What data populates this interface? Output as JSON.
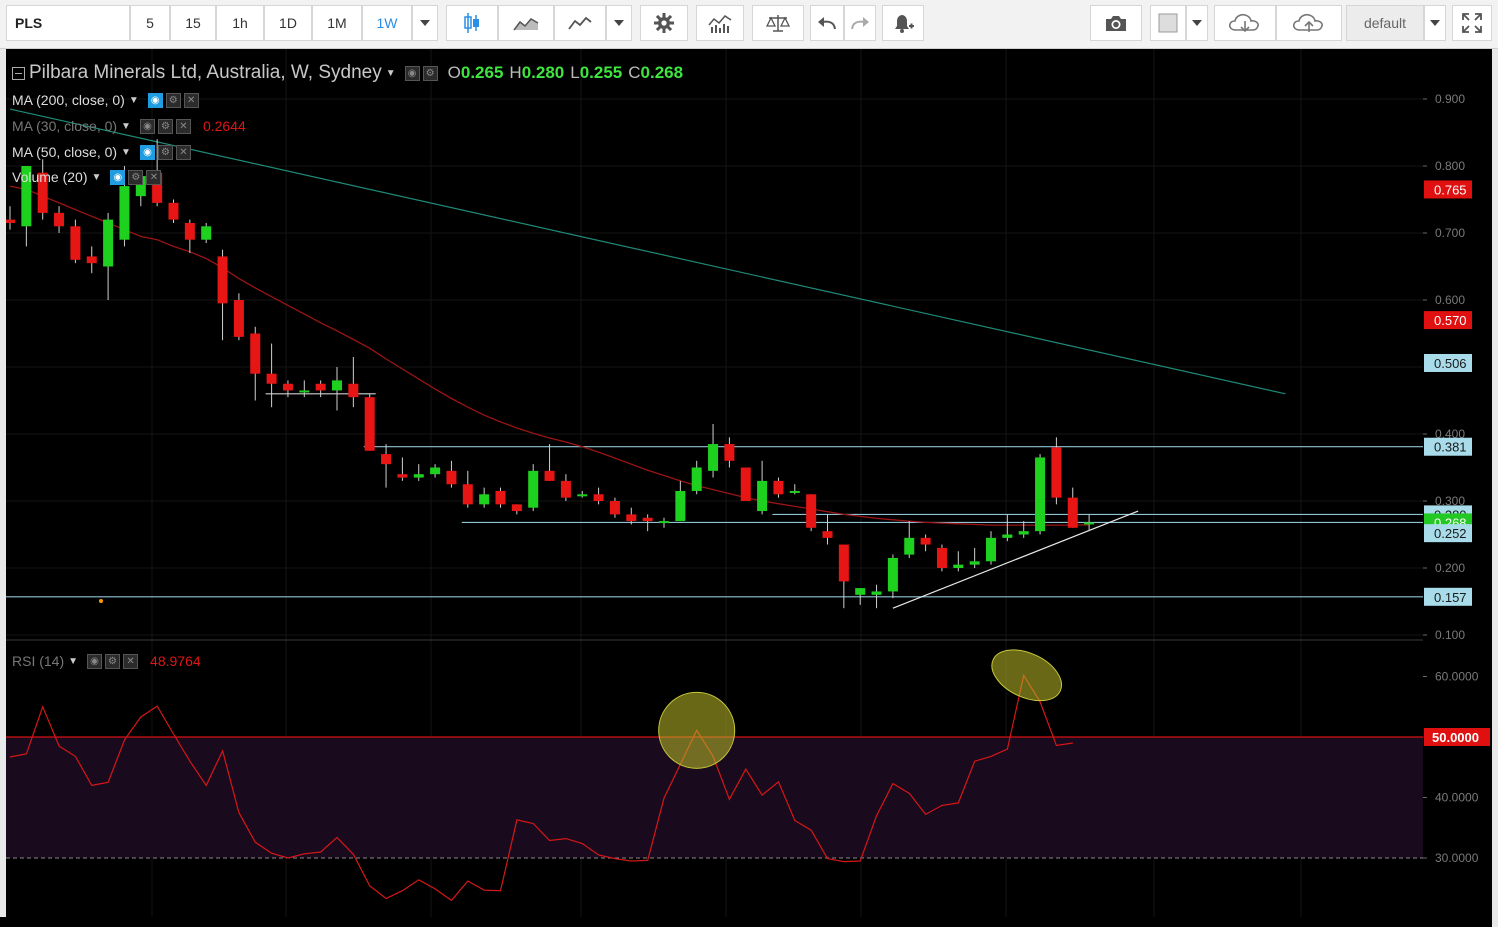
{
  "toolbar": {
    "symbol": "PLS",
    "intervals": [
      "5",
      "15",
      "1h",
      "1D",
      "1M",
      "1W"
    ],
    "active_interval": "1W",
    "layout_name": "default"
  },
  "legend": {
    "title": "Pilbara Minerals Ltd, Australia, W, Sydney",
    "ohlc": {
      "o_label": "O",
      "o": "0.265",
      "h_label": "H",
      "h": "0.280",
      "l_label": "L",
      "l": "0.255",
      "c_label": "C",
      "c": "0.268"
    },
    "indicators": [
      {
        "label": "MA (200, close, 0)",
        "value": ""
      },
      {
        "label": "MA (30, close, 0)",
        "value": "0.2644"
      },
      {
        "label": "MA (50, close, 0)",
        "value": ""
      },
      {
        "label": "Volume (20)",
        "value": ""
      }
    ],
    "rsi": {
      "label": "RSI (14)",
      "value": "48.9764"
    }
  },
  "price_axis": {
    "ticks": [
      "0.900",
      "0.800",
      "0.700",
      "0.600",
      "0.400",
      "0.300",
      "0.200",
      "0.100"
    ],
    "badges": [
      {
        "text": "0.765",
        "color": "#e01010",
        "value": 0.765
      },
      {
        "text": "0.570",
        "color": "#e01010",
        "value": 0.57
      },
      {
        "text": "0.506",
        "color": "#a9dcea",
        "value": 0.506
      },
      {
        "text": "0.381",
        "color": "#a9dcea",
        "value": 0.381
      },
      {
        "text": "0.280",
        "color": "#a9dcea",
        "value": 0.28
      },
      {
        "text": "0.268",
        "color": "#22c922",
        "value": 0.268
      },
      {
        "text": "0.252",
        "color": "#a9dcea",
        "value": 0.252
      },
      {
        "text": "0.157",
        "color": "#a9dcea",
        "value": 0.157
      }
    ]
  },
  "rsi_axis": {
    "ticks": [
      "60.0000",
      "40.0000",
      "30.0000"
    ],
    "badge": {
      "text": "50.0000",
      "value": 50
    }
  },
  "chart_data": {
    "type": "candlestick",
    "price_scale": {
      "min": 0.1,
      "max": 0.9
    },
    "up_color": "#1fd11f",
    "down_color": "#e81515",
    "candles": [
      {
        "o": 0.72,
        "h": 0.74,
        "l": 0.705,
        "c": 0.715
      },
      {
        "o": 0.71,
        "h": 0.77,
        "l": 0.68,
        "c": 0.8
      },
      {
        "o": 0.79,
        "h": 0.81,
        "l": 0.72,
        "c": 0.73
      },
      {
        "o": 0.73,
        "h": 0.74,
        "l": 0.7,
        "c": 0.71
      },
      {
        "o": 0.71,
        "h": 0.72,
        "l": 0.655,
        "c": 0.66
      },
      {
        "o": 0.665,
        "h": 0.68,
        "l": 0.64,
        "c": 0.655
      },
      {
        "o": 0.65,
        "h": 0.73,
        "l": 0.6,
        "c": 0.72
      },
      {
        "o": 0.69,
        "h": 0.8,
        "l": 0.68,
        "c": 0.77
      },
      {
        "o": 0.755,
        "h": 0.79,
        "l": 0.74,
        "c": 0.785
      },
      {
        "o": 0.79,
        "h": 0.84,
        "l": 0.74,
        "c": 0.745
      },
      {
        "o": 0.745,
        "h": 0.75,
        "l": 0.715,
        "c": 0.72
      },
      {
        "o": 0.715,
        "h": 0.72,
        "l": 0.67,
        "c": 0.69
      },
      {
        "o": 0.69,
        "h": 0.715,
        "l": 0.685,
        "c": 0.71
      },
      {
        "o": 0.665,
        "h": 0.675,
        "l": 0.54,
        "c": 0.595
      },
      {
        "o": 0.6,
        "h": 0.61,
        "l": 0.54,
        "c": 0.545
      },
      {
        "o": 0.55,
        "h": 0.56,
        "l": 0.45,
        "c": 0.49
      },
      {
        "o": 0.49,
        "h": 0.535,
        "l": 0.44,
        "c": 0.475
      },
      {
        "o": 0.475,
        "h": 0.48,
        "l": 0.455,
        "c": 0.465
      },
      {
        "o": 0.465,
        "h": 0.48,
        "l": 0.455,
        "c": 0.465
      },
      {
        "o": 0.475,
        "h": 0.48,
        "l": 0.455,
        "c": 0.465
      },
      {
        "o": 0.465,
        "h": 0.5,
        "l": 0.435,
        "c": 0.48
      },
      {
        "o": 0.475,
        "h": 0.515,
        "l": 0.44,
        "c": 0.455
      },
      {
        "o": 0.455,
        "h": 0.46,
        "l": 0.375,
        "c": 0.375
      },
      {
        "o": 0.37,
        "h": 0.385,
        "l": 0.32,
        "c": 0.355
      },
      {
        "o": 0.34,
        "h": 0.365,
        "l": 0.33,
        "c": 0.335
      },
      {
        "o": 0.335,
        "h": 0.355,
        "l": 0.33,
        "c": 0.34
      },
      {
        "o": 0.34,
        "h": 0.355,
        "l": 0.335,
        "c": 0.35
      },
      {
        "o": 0.345,
        "h": 0.36,
        "l": 0.32,
        "c": 0.325
      },
      {
        "o": 0.325,
        "h": 0.345,
        "l": 0.29,
        "c": 0.295
      },
      {
        "o": 0.295,
        "h": 0.32,
        "l": 0.29,
        "c": 0.31
      },
      {
        "o": 0.315,
        "h": 0.32,
        "l": 0.29,
        "c": 0.295
      },
      {
        "o": 0.295,
        "h": 0.295,
        "l": 0.28,
        "c": 0.285
      },
      {
        "o": 0.29,
        "h": 0.355,
        "l": 0.285,
        "c": 0.345
      },
      {
        "o": 0.345,
        "h": 0.385,
        "l": 0.33,
        "c": 0.33
      },
      {
        "o": 0.33,
        "h": 0.34,
        "l": 0.3,
        "c": 0.305
      },
      {
        "o": 0.31,
        "h": 0.315,
        "l": 0.305,
        "c": 0.31
      },
      {
        "o": 0.31,
        "h": 0.32,
        "l": 0.295,
        "c": 0.3
      },
      {
        "o": 0.3,
        "h": 0.305,
        "l": 0.275,
        "c": 0.28
      },
      {
        "o": 0.28,
        "h": 0.29,
        "l": 0.265,
        "c": 0.27
      },
      {
        "o": 0.275,
        "h": 0.28,
        "l": 0.255,
        "c": 0.27
      },
      {
        "o": 0.27,
        "h": 0.275,
        "l": 0.26,
        "c": 0.27
      },
      {
        "o": 0.27,
        "h": 0.33,
        "l": 0.27,
        "c": 0.315
      },
      {
        "o": 0.315,
        "h": 0.36,
        "l": 0.31,
        "c": 0.35
      },
      {
        "o": 0.345,
        "h": 0.415,
        "l": 0.335,
        "c": 0.385
      },
      {
        "o": 0.385,
        "h": 0.395,
        "l": 0.35,
        "c": 0.36
      },
      {
        "o": 0.35,
        "h": 0.35,
        "l": 0.3,
        "c": 0.3
      },
      {
        "o": 0.285,
        "h": 0.36,
        "l": 0.28,
        "c": 0.33
      },
      {
        "o": 0.33,
        "h": 0.335,
        "l": 0.305,
        "c": 0.31
      },
      {
        "o": 0.315,
        "h": 0.325,
        "l": 0.31,
        "c": 0.315
      },
      {
        "o": 0.31,
        "h": 0.31,
        "l": 0.255,
        "c": 0.26
      },
      {
        "o": 0.255,
        "h": 0.28,
        "l": 0.235,
        "c": 0.245
      },
      {
        "o": 0.235,
        "h": 0.235,
        "l": 0.14,
        "c": 0.18
      },
      {
        "o": 0.16,
        "h": 0.17,
        "l": 0.145,
        "c": 0.17
      },
      {
        "o": 0.16,
        "h": 0.175,
        "l": 0.14,
        "c": 0.165
      },
      {
        "o": 0.165,
        "h": 0.22,
        "l": 0.155,
        "c": 0.215
      },
      {
        "o": 0.22,
        "h": 0.27,
        "l": 0.215,
        "c": 0.245
      },
      {
        "o": 0.245,
        "h": 0.25,
        "l": 0.225,
        "c": 0.235
      },
      {
        "o": 0.23,
        "h": 0.235,
        "l": 0.195,
        "c": 0.2
      },
      {
        "o": 0.2,
        "h": 0.225,
        "l": 0.195,
        "c": 0.205
      },
      {
        "o": 0.205,
        "h": 0.23,
        "l": 0.2,
        "c": 0.21
      },
      {
        "o": 0.21,
        "h": 0.255,
        "l": 0.205,
        "c": 0.245
      },
      {
        "o": 0.245,
        "h": 0.28,
        "l": 0.24,
        "c": 0.25
      },
      {
        "o": 0.25,
        "h": 0.27,
        "l": 0.245,
        "c": 0.255
      },
      {
        "o": 0.255,
        "h": 0.37,
        "l": 0.25,
        "c": 0.365
      },
      {
        "o": 0.38,
        "h": 0.395,
        "l": 0.295,
        "c": 0.305
      },
      {
        "o": 0.305,
        "h": 0.32,
        "l": 0.26,
        "c": 0.26
      },
      {
        "o": 0.265,
        "h": 0.28,
        "l": 0.255,
        "c": 0.268
      }
    ],
    "ma30": [
      0.77,
      0.765,
      0.755,
      0.745,
      0.735,
      0.725,
      0.715,
      0.705,
      0.695,
      0.69,
      0.68,
      0.672,
      0.662,
      0.648,
      0.632,
      0.618,
      0.605,
      0.592,
      0.579,
      0.566,
      0.554,
      0.541,
      0.528,
      0.512,
      0.497,
      0.482,
      0.467,
      0.453,
      0.44,
      0.428,
      0.418,
      0.409,
      0.401,
      0.394,
      0.388,
      0.381,
      0.373,
      0.364,
      0.355,
      0.346,
      0.338,
      0.33,
      0.323,
      0.317,
      0.311,
      0.305,
      0.3,
      0.296,
      0.292,
      0.288,
      0.284,
      0.28,
      0.277,
      0.274,
      0.272,
      0.27,
      0.268,
      0.267,
      0.266,
      0.265,
      0.264,
      0.264,
      0.264,
      0.264,
      0.264,
      0.264,
      0.2644
    ],
    "horizontal_lines": [
      {
        "value": 0.157,
        "from": 0
      },
      {
        "value": 0.381,
        "from": 22
      },
      {
        "value": 0.268,
        "from": 28
      },
      {
        "value": 0.28,
        "from": 47
      },
      {
        "value": 0.46,
        "from": 16,
        "to": 22
      }
    ],
    "trend_lines": [
      {
        "from": [
          0,
          0.885
        ],
        "to": [
          78,
          0.46
        ]
      },
      {
        "from": [
          54,
          0.14
        ],
        "to": [
          69,
          0.285
        ]
      }
    ],
    "rsi": {
      "scale": {
        "min": 20,
        "max": 67
      },
      "upper_level": 50,
      "lower_level": 30,
      "values": [
        46.7,
        47.2,
        55.0,
        48.5,
        46.8,
        42.0,
        42.5,
        49.5,
        53.3,
        55.1,
        50.5,
        46.0,
        42.0,
        47.7,
        37.5,
        32.6,
        30.8,
        30.0,
        30.7,
        31.0,
        33.4,
        30.6,
        25.4,
        23.3,
        24.6,
        26.4,
        24.9,
        23.0,
        26.2,
        24.7,
        24.6,
        36.3,
        35.7,
        32.9,
        33.2,
        32.4,
        30.5,
        29.9,
        29.5,
        29.6,
        39.9,
        45.5,
        51.1,
        46.8,
        39.7,
        44.7,
        40.4,
        42.6,
        36.2,
        34.6,
        29.9,
        29.4,
        29.5,
        37.0,
        42.3,
        40.7,
        37.2,
        38.7,
        39.1,
        46.0,
        46.8,
        48.0,
        60.2,
        55.8,
        48.6,
        49.0
      ],
      "highlight_circles": [
        42,
        62
      ]
    }
  }
}
